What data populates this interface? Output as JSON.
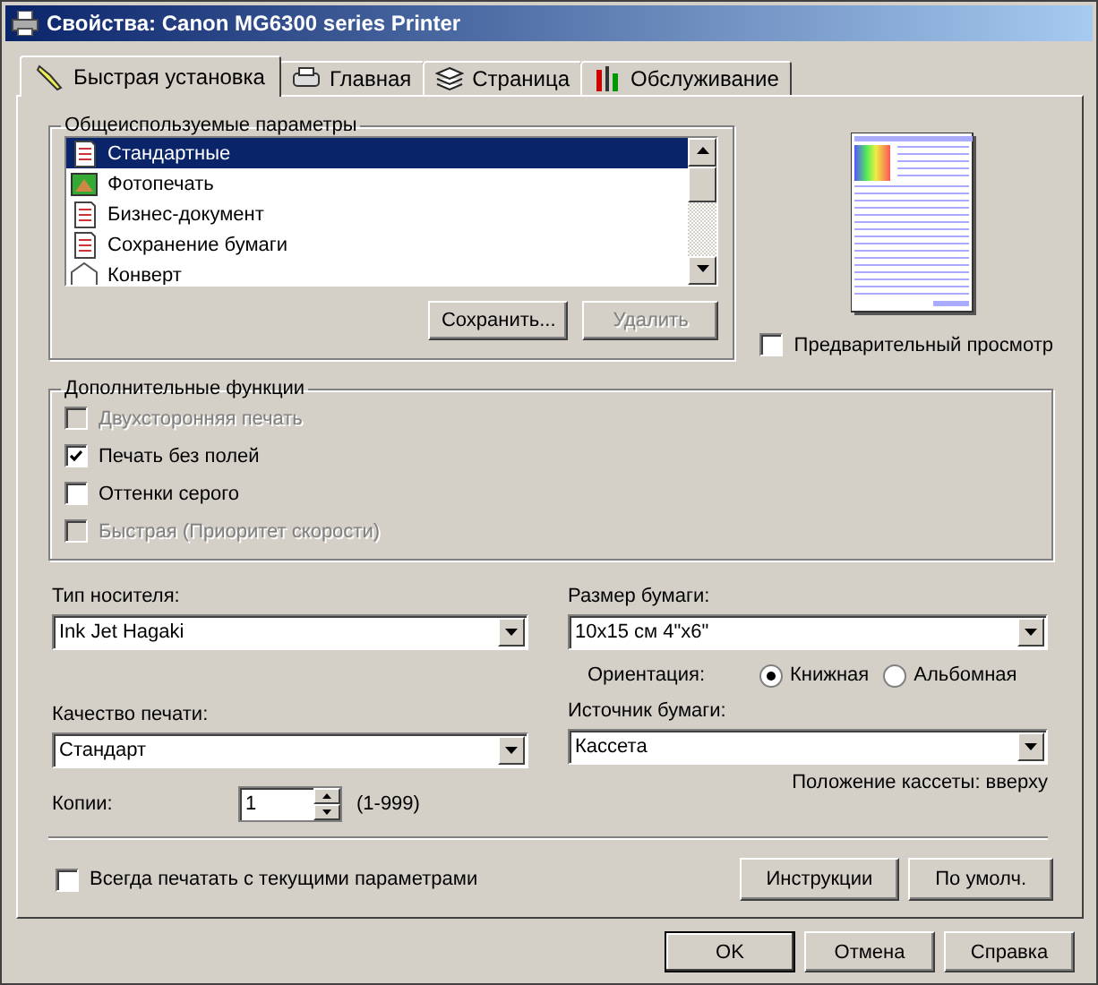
{
  "window": {
    "title": "Свойства: Canon MG6300 series Printer"
  },
  "tabs": [
    {
      "label": "Быстрая установка",
      "selected": true
    },
    {
      "label": "Главная",
      "selected": false
    },
    {
      "label": "Страница",
      "selected": false
    },
    {
      "label": "Обслуживание",
      "selected": false
    }
  ],
  "presets": {
    "title": "Общеиспользуемые параметры",
    "items": [
      {
        "label": "Стандартные",
        "selected": true
      },
      {
        "label": "Фотопечать",
        "selected": false
      },
      {
        "label": "Бизнес-документ",
        "selected": false
      },
      {
        "label": "Сохранение бумаги",
        "selected": false
      },
      {
        "label": "Конверт",
        "selected": false
      }
    ],
    "buttons": [
      {
        "label": "Сохранить...",
        "disabled": false
      },
      {
        "label": "Удалить",
        "disabled": true
      }
    ]
  },
  "preview": {
    "label": "Предварительный просмотр",
    "checked": false
  },
  "extra": {
    "title": "Дополнительные функции",
    "options": [
      {
        "label": "Двухсторонняя печать",
        "checked": false,
        "disabled": true
      },
      {
        "label": "Печать без полей",
        "checked": true,
        "disabled": false
      },
      {
        "label": "Оттенки серого",
        "checked": false,
        "disabled": false
      },
      {
        "label": "Быстрая (Приоритет скорости)",
        "checked": false,
        "disabled": true
      }
    ]
  },
  "media_type": {
    "label": "Тип носителя:",
    "value": "Ink Jet Hagaki"
  },
  "paper_size": {
    "label": "Размер бумаги:",
    "value": "10x15 см 4\"x6\""
  },
  "orientation": {
    "label": "Ориентация:",
    "options": [
      {
        "label": "Книжная",
        "selected": true
      },
      {
        "label": "Альбомная",
        "selected": false
      }
    ]
  },
  "print_quality": {
    "label": "Качество печати:",
    "value": "Стандарт"
  },
  "paper_source": {
    "label": "Источник бумаги:",
    "value": "Кассета"
  },
  "cassette_note": "Положение кассеты: вверху",
  "copies": {
    "label": "Копии:",
    "value": "1",
    "range": "(1-999)"
  },
  "always_print": {
    "label": "Всегда печатать с текущими параметрами",
    "checked": false
  },
  "panel_buttons": [
    "Инструкции",
    "По умолч."
  ],
  "dialog_buttons": [
    {
      "label": "OK",
      "default": true
    },
    {
      "label": "Отмена",
      "default": false
    },
    {
      "label": "Справка",
      "default": false
    }
  ]
}
